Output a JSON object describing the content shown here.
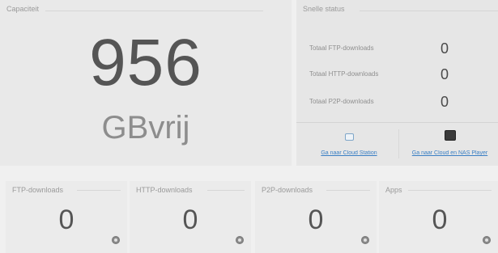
{
  "capacity": {
    "title": "Capaciteit",
    "value": "956",
    "unit": "GBvrij"
  },
  "status": {
    "title": "Snelle status",
    "rows": [
      {
        "label": "Totaal FTP-downloads",
        "value": "0"
      },
      {
        "label": "Totaal HTTP-downloads",
        "value": "0"
      },
      {
        "label": "Totaal P2P-downloads",
        "value": "0"
      }
    ],
    "link_left": "Ga naar Cloud Station",
    "link_right": "Ga naar Cloud en NAS Player"
  },
  "tiles": [
    {
      "title": "FTP-downloads",
      "value": "0"
    },
    {
      "title": "HTTP-downloads",
      "value": "0"
    },
    {
      "title": "P2P-downloads",
      "value": "0"
    },
    {
      "title": "Apps",
      "value": "0"
    }
  ]
}
